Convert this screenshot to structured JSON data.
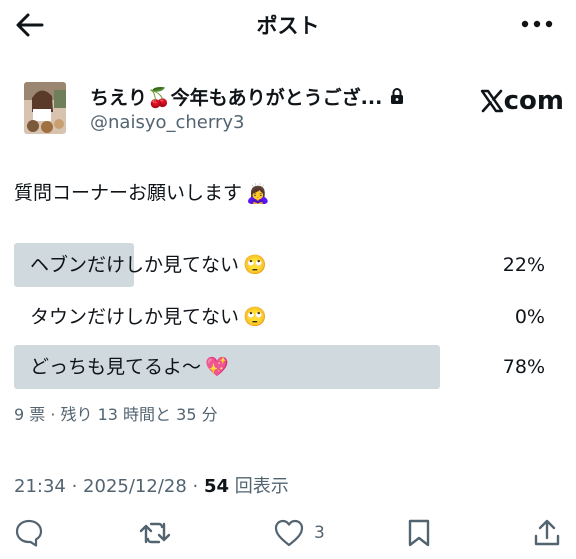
{
  "header": {
    "title": "ポスト"
  },
  "author": {
    "display_name": "ちえり🍒今年もありがとうござ...",
    "handle": "@naisyo_cherry3",
    "watermark": "com"
  },
  "post": {
    "text": "質問コーナーお願いします",
    "text_emoji": "🙇‍♀️"
  },
  "poll": {
    "options": [
      {
        "label": "ヘブンだけしか見てない",
        "emoji": "🙄",
        "percent_text": "22%",
        "percent": 22
      },
      {
        "label": "タウンだけしか見てない",
        "emoji": "🙄",
        "percent_text": "0%",
        "percent": 0
      },
      {
        "label": "どっちも見てるよ〜",
        "emoji": "💖",
        "percent_text": "78%",
        "percent": 78
      }
    ],
    "meta": "9 票 · 残り 13 時間と 35 分"
  },
  "timestamp": {
    "time_date": "21:34 · 2025/12/28 · ",
    "views_count": "54",
    "views_label": " 回表示"
  },
  "actions": {
    "like_count": "3"
  },
  "colors": {
    "bar": "#cfd9de",
    "muted": "#536471",
    "text": "#0f1419"
  }
}
